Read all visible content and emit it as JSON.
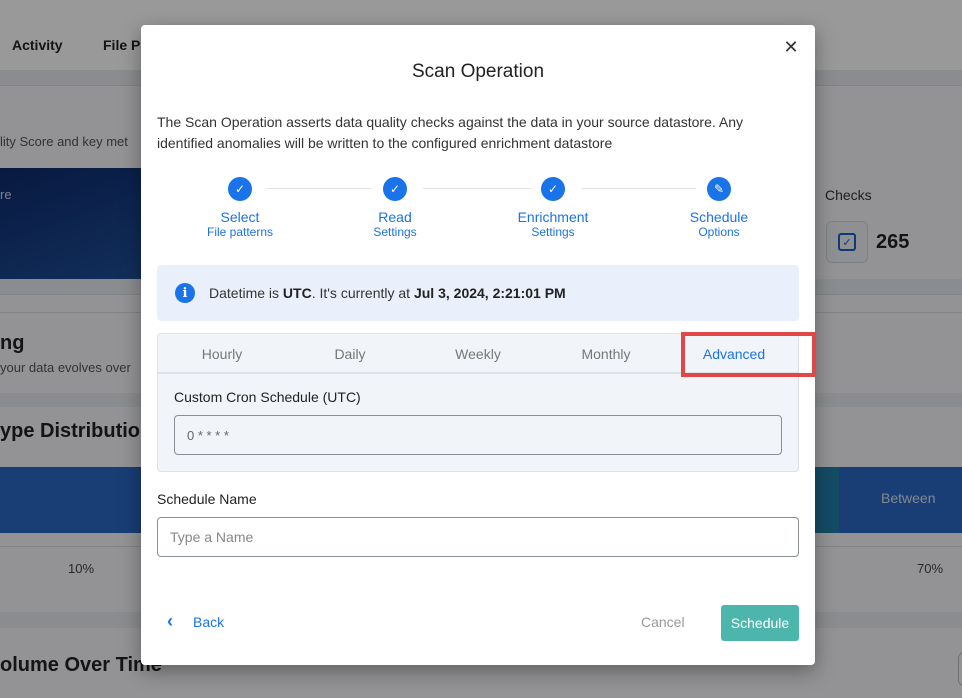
{
  "background": {
    "nav_tabs": [
      "Activity",
      "File Pa"
    ],
    "subtitle": "lity Score and key met",
    "hero_label": "re",
    "checks": {
      "label": "Checks",
      "value": "265",
      "icon": "checklist-icon"
    },
    "section2": {
      "title": "ng",
      "subtitle": "your data evolves over"
    },
    "section3": {
      "title": "ype Distribution",
      "bar_label": "Between",
      "pct_left": "10%",
      "pct_right": "70%"
    },
    "section4": {
      "title": "olume Over Time"
    }
  },
  "modal": {
    "title": "Scan Operation",
    "description": "The Scan Operation asserts data quality checks against the data in your source datastore. Any identified anomalies will be written to the configured enrichment datastore",
    "close_icon": "close-icon",
    "steps": [
      {
        "title": "Select",
        "subtitle": "File patterns",
        "state": "completed",
        "icon": "check-icon"
      },
      {
        "title": "Read",
        "subtitle": "Settings",
        "state": "completed",
        "icon": "check-icon"
      },
      {
        "title": "Enrichment",
        "subtitle": "Settings",
        "state": "completed",
        "icon": "check-icon"
      },
      {
        "title": "Schedule",
        "subtitle": "Options",
        "state": "active",
        "icon": "pencil-icon"
      }
    ],
    "info": {
      "prefix": "Datetime is ",
      "timezone": "UTC",
      "middle": ". It's currently at ",
      "datetime": "Jul 3, 2024, 2:21:01 PM"
    },
    "tabs": [
      {
        "label": "Hourly",
        "active": false
      },
      {
        "label": "Daily",
        "active": false
      },
      {
        "label": "Weekly",
        "active": false
      },
      {
        "label": "Monthly",
        "active": false
      },
      {
        "label": "Advanced",
        "active": true
      }
    ],
    "cron": {
      "label": "Custom Cron Schedule (UTC)",
      "value": "0 * * * *"
    },
    "schedule_name": {
      "label": "Schedule Name",
      "placeholder": "Type a Name",
      "value": ""
    },
    "footer": {
      "back": "Back",
      "cancel": "Cancel",
      "submit": "Schedule"
    },
    "colors": {
      "primary": "#1a73e8",
      "submit": "#4db6ac",
      "highlight": "#e04848"
    }
  }
}
